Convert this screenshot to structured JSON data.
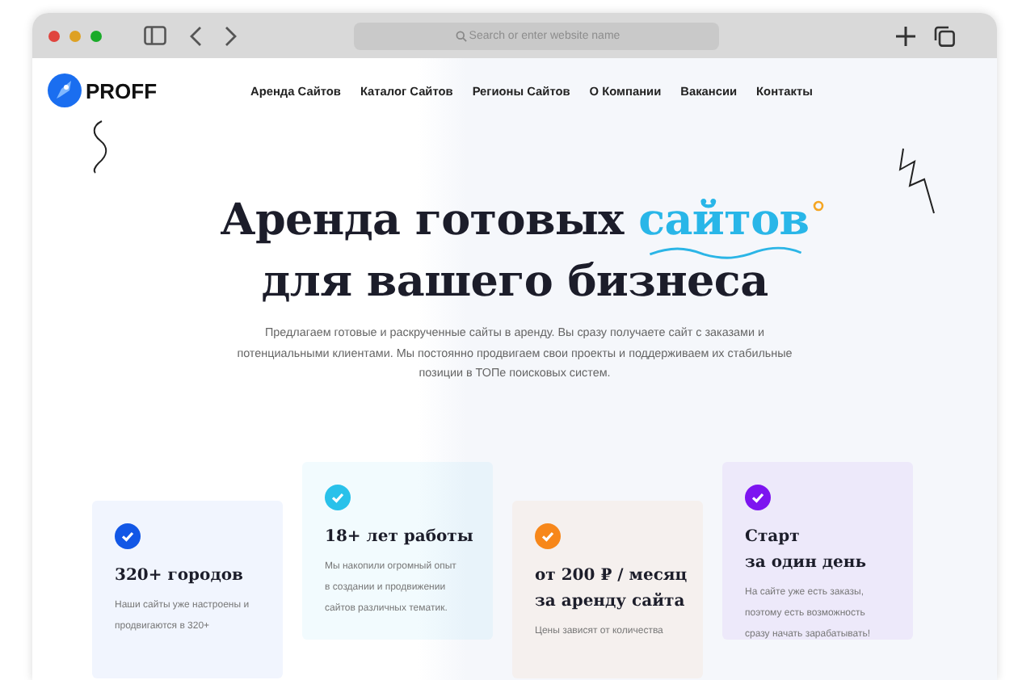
{
  "browser": {
    "address_placeholder": "Search or enter website name"
  },
  "logo": {
    "text": "PROFF"
  },
  "nav": [
    "Аренда Сайтов",
    "Каталог Сайтов",
    "Регионы Сайтов",
    "О Компании",
    "Вакансии",
    "Контакты"
  ],
  "hero": {
    "title_start": "Аренда готовых",
    "title_highlight": "сайтов",
    "title_end": "для вашего бизнеса",
    "text": "Предлагаем готовые и раскрученные сайты в аренду. Вы сразу получаете сайт с заказами и потенциальными клиентами. Мы постоянно продвигаем свои проекты и поддерживаем их стабильные позиции в ТОПе поисковых систем."
  },
  "cards": [
    {
      "title": [
        "320+ городов"
      ],
      "text": [
        "Наши сайты уже настроены и",
        "продвигаются в 320+"
      ],
      "color": "#1257e6"
    },
    {
      "title": [
        "18+ лет работы"
      ],
      "text": [
        "Мы накопили огромный опыт",
        "в создании и продвижении",
        "сайтов различных тематик."
      ],
      "color": "#29c1ea"
    },
    {
      "title": [
        "от 200 ₽ / месяц",
        "за аренду сайта"
      ],
      "text": [
        "Цены зависят от количества"
      ],
      "color": "#f7871a"
    },
    {
      "title": [
        "Старт",
        "за один день"
      ],
      "text": [
        "На сайте уже есть заказы,",
        "поэтому есть возможность",
        "сразу начать зарабатывать!"
      ],
      "color": "#7d14f0"
    }
  ]
}
